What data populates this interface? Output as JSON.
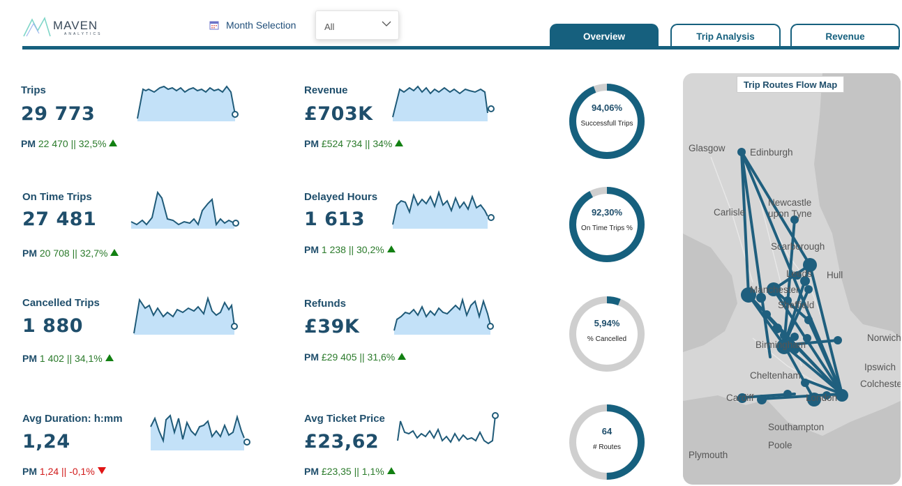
{
  "brand": {
    "logo_main": "MAVEN",
    "logo_sub": "ANALYTICS"
  },
  "filter": {
    "label": "Month Selection",
    "value": "All",
    "icon": "calendar-icon"
  },
  "tabs": [
    {
      "label": "Overview",
      "active": true
    },
    {
      "label": "Trip Analysis",
      "active": false
    },
    {
      "label": "Revenue",
      "active": false
    }
  ],
  "kpis": {
    "trips": {
      "title": "Trips",
      "value": "29 773",
      "pm_prefix": "PM",
      "pm_text": "22 470 || 32,5%",
      "trend": "up"
    },
    "on_time": {
      "title": "On Time Trips",
      "value": "27 481",
      "pm_prefix": "PM",
      "pm_text": "20 708 || 32,7%",
      "trend": "up"
    },
    "cancelled": {
      "title": "Cancelled Trips",
      "value": "1 880",
      "pm_prefix": "PM",
      "pm_text": "1 402 || 34,1%",
      "trend": "up"
    },
    "avg_duration": {
      "title": "Avg Duration: h:mm",
      "value": "1,24",
      "pm_prefix": "PM",
      "pm_text": "1,24 || -0,1%",
      "trend": "down"
    },
    "revenue": {
      "title": "Revenue",
      "value": "£703K",
      "pm_prefix": "PM",
      "pm_text": "£524 734 || 34%",
      "trend": "up"
    },
    "delayed": {
      "title": "Delayed Hours",
      "value": "1 613",
      "pm_prefix": "PM",
      "pm_text": "1 238 || 30,2%",
      "trend": "up"
    },
    "refunds": {
      "title": "Refunds",
      "value": "£39K",
      "pm_prefix": "PM",
      "pm_text": "£29 405 || 31,6%",
      "trend": "up"
    },
    "avg_ticket": {
      "title": "Avg Ticket Price",
      "value": "£23,62",
      "pm_prefix": "PM",
      "pm_text": "£23,35 || 1,1%",
      "trend": "up"
    }
  },
  "donuts": [
    {
      "value": "94,06%",
      "label": "Successfull Trips",
      "fraction": 0.9406
    },
    {
      "value": "92,30%",
      "label": "On Time Trips %",
      "fraction": 0.923
    },
    {
      "value": "5,94%",
      "label": "% Cancelled",
      "fraction": 0.0594
    },
    {
      "value": "64",
      "label": "# Routes",
      "fraction": 0.5
    }
  ],
  "map": {
    "title": "Trip Routes Flow Map",
    "cities": [
      "Glasgow",
      "Edinburgh",
      "Newcastle upon Tyne",
      "Carlisle",
      "Scarborough",
      "Hull",
      "Leeds",
      "Manchester",
      "Sheffield",
      "Birmingham",
      "Norwich",
      "Ipswich",
      "Colchester",
      "Cheltenham",
      "Cardiff",
      "London",
      "Southampton",
      "Poole",
      "Plymouth"
    ]
  },
  "colors": {
    "primary": "#16607e",
    "positive": "#128012",
    "negative": "#e01515",
    "donut_track": "#cfcfcf",
    "spark_fill": "#a9d4f5"
  }
}
